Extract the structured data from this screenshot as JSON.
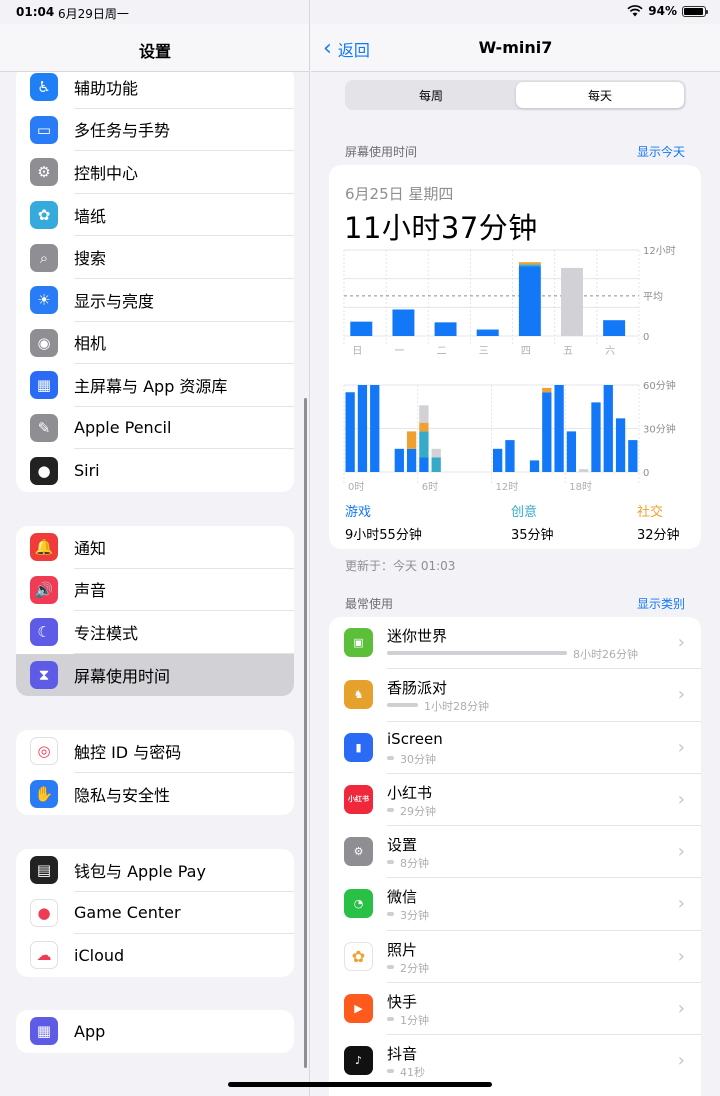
{
  "status": {
    "time": "01:04",
    "date": "6月29日周一",
    "battery": "94%",
    "battery_level": 0.94
  },
  "sidebar": {
    "title": "设置",
    "group1": [
      {
        "label": "辅助功能",
        "icon": "accessibility-icon",
        "color": "#1f7ff5",
        "glyph": "♿"
      },
      {
        "label": "多任务与手势",
        "icon": "multitasking-icon",
        "color": "#2a7cf6",
        "glyph": "▭"
      },
      {
        "label": "控制中心",
        "icon": "control-center-icon",
        "color": "#8e8e93",
        "glyph": "⚙"
      },
      {
        "label": "墙纸",
        "icon": "wallpaper-icon",
        "color": "#36aadc",
        "glyph": "✿"
      },
      {
        "label": "搜索",
        "icon": "search-icon",
        "color": "#8e8e93",
        "glyph": "⌕"
      },
      {
        "label": "显示与亮度",
        "icon": "brightness-icon",
        "color": "#2a7cf6",
        "glyph": "☀"
      },
      {
        "label": "相机",
        "icon": "camera-icon",
        "color": "#8e8e93",
        "glyph": "◉"
      },
      {
        "label": "主屏幕与 App 资源库",
        "icon": "home-screen-icon",
        "color": "#2a6af5",
        "glyph": "▦"
      },
      {
        "label": "Apple Pencil",
        "icon": "pencil-icon",
        "color": "#8e8e93",
        "glyph": "✎"
      },
      {
        "label": "Siri",
        "icon": "siri-icon",
        "color": "#222222",
        "glyph": "●"
      }
    ],
    "group2": [
      {
        "label": "通知",
        "icon": "notifications-icon",
        "color": "#f03b3b",
        "glyph": "🔔"
      },
      {
        "label": "声音",
        "icon": "sounds-icon",
        "color": "#f03b55",
        "glyph": "🔊"
      },
      {
        "label": "专注模式",
        "icon": "focus-icon",
        "color": "#5e5ce6",
        "glyph": "☾"
      },
      {
        "label": "屏幕使用时间",
        "icon": "screen-time-icon",
        "color": "#5e5ce6",
        "glyph": "⧗"
      }
    ],
    "group3": [
      {
        "label": "触控 ID 与密码",
        "icon": "touch-id-icon",
        "color": "#ffffff",
        "glyph": "◎"
      },
      {
        "label": "隐私与安全性",
        "icon": "privacy-icon",
        "color": "#2a7cf6",
        "glyph": "✋"
      }
    ],
    "group4": [
      {
        "label": "钱包与 Apple Pay",
        "icon": "wallet-icon",
        "color": "#222222",
        "glyph": "▤"
      },
      {
        "label": "Game Center",
        "icon": "game-center-icon",
        "color": "#ffffff",
        "glyph": "●"
      },
      {
        "label": "iCloud",
        "icon": "icloud-icon",
        "color": "#ffffff",
        "glyph": "☁"
      }
    ],
    "group5": [
      {
        "label": "App",
        "icon": "apps-icon",
        "color": "#5e5ce6",
        "glyph": "▦"
      }
    ]
  },
  "detail": {
    "back": "返回",
    "title": "W-mini7",
    "seg_week": "每周",
    "seg_day": "每天",
    "section1": "屏幕使用时间",
    "show_today": "显示今天",
    "date": "6月25日 星期四",
    "total": "11小时37分钟",
    "updated": "更新于：今天 01:03",
    "section2": "最常使用",
    "show_categories": "显示类别",
    "categories": [
      {
        "name": "游戏",
        "value": "9小时55分钟",
        "color": "#1378f7"
      },
      {
        "name": "创意",
        "value": "35分钟",
        "color": "#37aac8"
      },
      {
        "name": "社交",
        "value": "32分钟",
        "color": "#f0a030"
      }
    ]
  },
  "chart_data": [
    {
      "type": "bar",
      "categories": [
        "日",
        "一",
        "二",
        "三",
        "四",
        "五",
        "六"
      ],
      "series": [
        {
          "values": [
            2.0,
            3.7,
            1.9,
            0.9,
            9.7,
            0,
            2.2
          ],
          "color": "#1378f7"
        },
        {
          "values": [
            0,
            0,
            0,
            0,
            0.3,
            0,
            0
          ],
          "color": "#37aac8"
        },
        {
          "values": [
            0,
            0,
            0,
            0,
            0.3,
            0,
            0
          ],
          "color": "#f0a030"
        }
      ],
      "gray_values": [
        2.0,
        3.7,
        1.9,
        0.9,
        0.3,
        9.5,
        2.2
      ],
      "ylim": [
        0,
        12
      ],
      "yticks": [
        "12小时",
        "平均",
        "0"
      ],
      "average": 5.6
    },
    {
      "type": "bar",
      "categories": [
        "0时",
        "6时",
        "12时",
        "18时"
      ],
      "hours": [
        0,
        1,
        2,
        3,
        4,
        5,
        6,
        7,
        8,
        9,
        10,
        11,
        12,
        13,
        14,
        15,
        16,
        17,
        18,
        19,
        20,
        21,
        22,
        23
      ],
      "series": [
        {
          "name": "游戏",
          "values": [
            1,
            55,
            60,
            60,
            0,
            16,
            16,
            10,
            0,
            0,
            0,
            0,
            0,
            16,
            22,
            0,
            8,
            55,
            60,
            28,
            0,
            48,
            60,
            37,
            22
          ],
          "color": "#1378f7"
        },
        {
          "name": "创意",
          "values": [
            0,
            0,
            0,
            0,
            0,
            0,
            18,
            10,
            0,
            0,
            0,
            0,
            0,
            0,
            0,
            0,
            0,
            0,
            0,
            0,
            0,
            0,
            0,
            0
          ],
          "color": "#37aac8"
        },
        {
          "name": "社交",
          "values": [
            0,
            0,
            0,
            0,
            0,
            12,
            6,
            0,
            0,
            0,
            0,
            0,
            0,
            0,
            0,
            0,
            3,
            0,
            0,
            0,
            0,
            0,
            0,
            0
          ],
          "color": "#f0a030"
        }
      ],
      "gray_values": [
        0,
        0,
        0,
        0,
        0,
        0,
        12,
        6,
        0,
        0,
        0,
        0,
        0,
        0,
        0,
        0,
        0,
        0,
        0,
        2,
        0,
        0,
        0,
        0
      ],
      "ylim": [
        0,
        60
      ],
      "yticks": [
        "60分钟",
        "30分钟",
        "0"
      ]
    }
  ],
  "apps": [
    {
      "name": "迷你世界",
      "time": "8小时26分钟",
      "frac": 1.0,
      "icon": "mini-world-icon",
      "color": "#5bbf3a",
      "glyph": "▣"
    },
    {
      "name": "香肠派对",
      "time": "1小时28分钟",
      "frac": 0.17,
      "icon": "sausage-party-icon",
      "color": "#e6a02c",
      "glyph": "♞"
    },
    {
      "name": "iScreen",
      "time": "30分钟",
      "frac": 0.03,
      "icon": "iscreen-icon",
      "color": "#2a6af5",
      "glyph": "▮"
    },
    {
      "name": "小红书",
      "time": "29分钟",
      "frac": 0.03,
      "icon": "xiaohongshu-icon",
      "color": "#f0283c",
      "glyph": "小红书"
    },
    {
      "name": "设置",
      "time": "8分钟",
      "frac": 0.02,
      "icon": "settings-icon",
      "color": "#8e8e93",
      "glyph": "⚙"
    },
    {
      "name": "微信",
      "time": "3分钟",
      "frac": 0.02,
      "icon": "wechat-icon",
      "color": "#28c045",
      "glyph": "◔"
    },
    {
      "name": "照片",
      "time": "2分钟",
      "frac": 0.02,
      "icon": "photos-icon",
      "color": "#ffffff",
      "glyph": "✿"
    },
    {
      "name": "快手",
      "time": "1分钟",
      "frac": 0.02,
      "icon": "kuaishou-icon",
      "color": "#ff5a1e",
      "glyph": "▶"
    },
    {
      "name": "抖音",
      "time": "41秒",
      "frac": 0.02,
      "icon": "douyin-icon",
      "color": "#111111",
      "glyph": "♪"
    }
  ]
}
